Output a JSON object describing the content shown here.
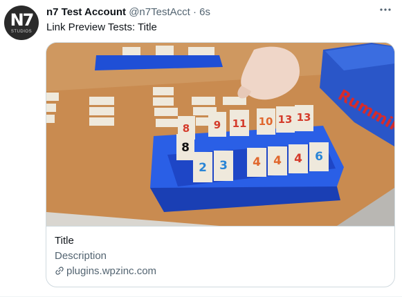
{
  "tweet": {
    "display_name": "n7 Test Account",
    "handle": "@n7TestAcct",
    "separator": "·",
    "time": "6s",
    "more_icon": "more-horizontal-icon",
    "text": "Link Preview Tests: Title",
    "avatar": {
      "mark": "N7",
      "sub": "STUDIOS"
    }
  },
  "card": {
    "image_description": "photo",
    "title": "Title",
    "description": "Description",
    "domain": "plugins.wpzinc.com",
    "link_icon": "link-icon"
  },
  "photo_art": {
    "tile_numbers_back": [
      "8",
      "9",
      "11",
      "10",
      "13",
      "13"
    ],
    "tile_numbers_front": [
      "8",
      "2",
      "3",
      "4",
      "4",
      "4",
      "6"
    ],
    "box_text": "Rummikub"
  },
  "colors": {
    "accent": "#1d9bf0",
    "text_primary": "#0f1419",
    "text_secondary": "#536471",
    "border": "#cfd9de",
    "rack_blue": "#1f4fd6",
    "table_wood": "#c98b50"
  }
}
